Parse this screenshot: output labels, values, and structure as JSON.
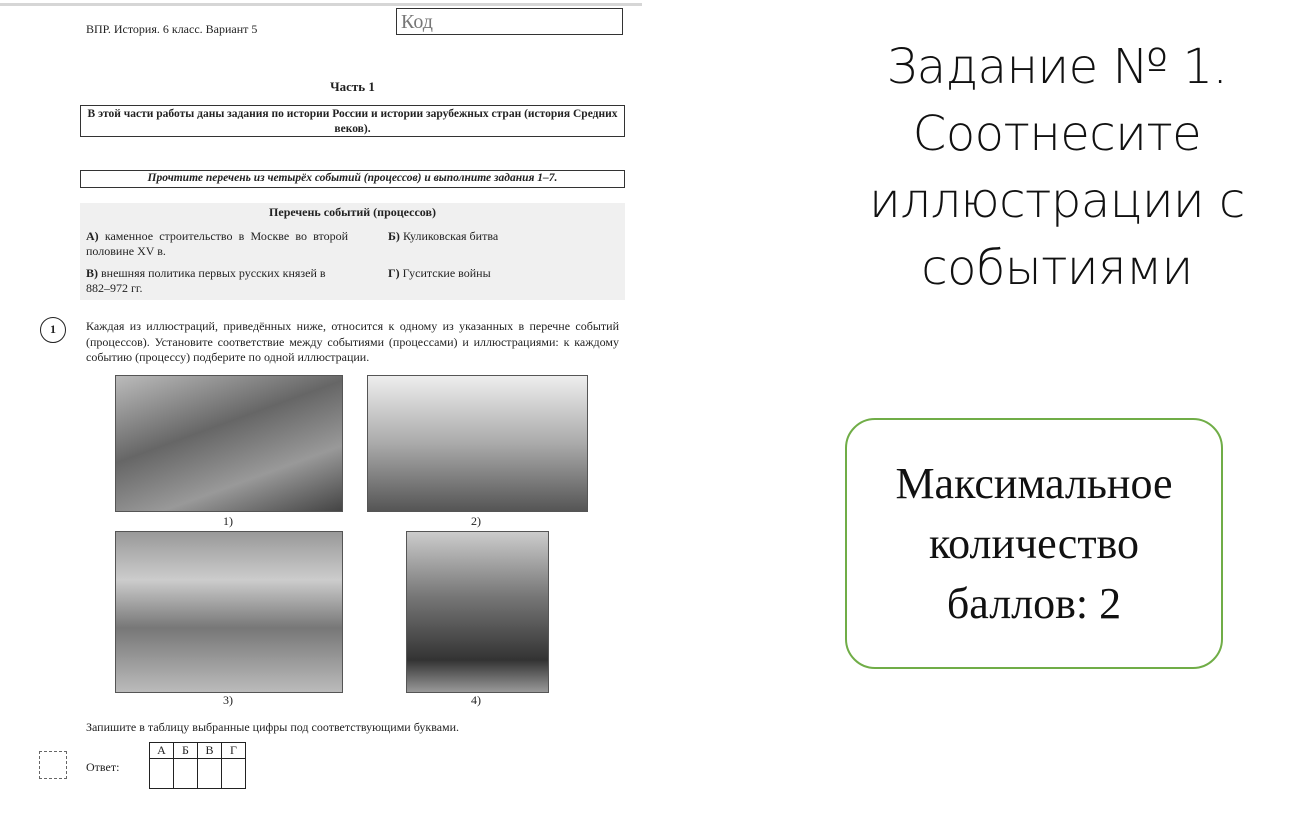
{
  "doc": {
    "header": "ВПР. История. 6 класс. Вариант 5",
    "code_label": "Код",
    "part": "Часть 1",
    "box1": "В этой части работы даны задания по истории России и истории зарубежных стран (история Средних веков).",
    "box2": "Прочтите перечень из четырёх событий (процессов) и выполните задания 1–7.",
    "list_title": "Перечень событий (процессов)",
    "events": [
      {
        "letter": "А)",
        "text": "каменное строительство в Москве во второй половине XV в."
      },
      {
        "letter": "Б)",
        "text": "Куликовская битва"
      },
      {
        "letter": "В)",
        "text": "внешняя политика первых русских князей в 882–972 гг."
      },
      {
        "letter": "Г)",
        "text": "Гуситские войны"
      }
    ],
    "task_number": "1",
    "task_text": "Каждая из иллюстраций, приведённых ниже, относится к одному из указанных в перечне событий (процессов). Установите соответствие между событиями (процессами) и иллюстрациями: к каждому событию (процессу) подберите по одной иллюстрации.",
    "image_labels": [
      "1)",
      "2)",
      "3)",
      "4)"
    ],
    "instruction": "Запишите в таблицу выбранные цифры под соответствующими буквами.",
    "answer_label": "Ответ:",
    "answer_headers": [
      "А",
      "Б",
      "В",
      "Г"
    ]
  },
  "slide": {
    "title": "Задание № 1. Соотнесите иллюстрации с событиями",
    "score": "Максимальное количество баллов: 2",
    "border_color": "#70ad47"
  }
}
